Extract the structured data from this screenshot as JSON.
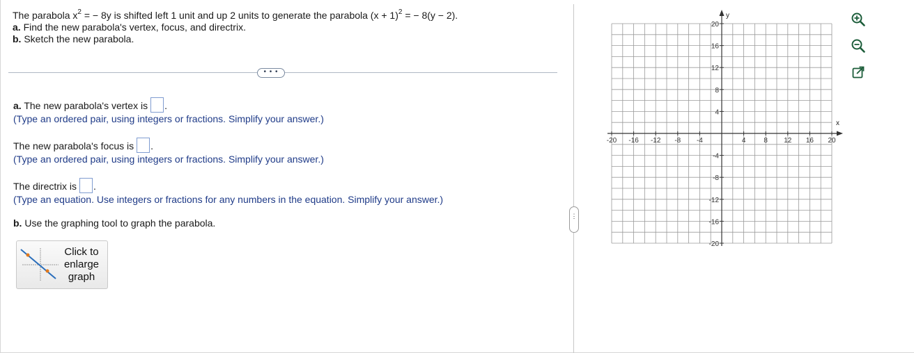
{
  "question": {
    "line1_pre": "The parabola x",
    "line1_exp1": "2",
    "line1_mid": " = − 8y is shifted left 1 unit and up 2 units to generate the parabola (x + 1)",
    "line1_exp2": "2",
    "line1_post": " = − 8(y − 2).",
    "part_a_label": "a.",
    "part_a_text": " Find the new parabola's vertex, focus, and directrix.",
    "part_b_label": "b.",
    "part_b_text": " Sketch the new parabola."
  },
  "expand_button": "• • •",
  "answers": {
    "vertex_label": "a.",
    "vertex_text": " The new parabola's vertex is",
    "vertex_hint": "(Type an ordered pair, using integers or fractions. Simplify your answer.)",
    "focus_text": "The new parabola's focus is",
    "focus_hint": "(Type an ordered pair, using integers or fractions. Simplify your answer.)",
    "directrix_text": "The directrix is",
    "directrix_hint": "(Type an equation. Use integers or fractions for any numbers in the equation. Simplify your answer.)",
    "graph_label": "b.",
    "graph_text": " Use the graphing tool to graph the parabola.",
    "period": "."
  },
  "enlarge_button": {
    "line1": "Click to",
    "line2": "enlarge",
    "line3": "graph"
  },
  "panel_handle": "⋮",
  "graph": {
    "x_range": [
      -20,
      20
    ],
    "y_range": [
      -20,
      20
    ],
    "grid_step": 2,
    "x_axis_label": "x",
    "y_axis_label": "y",
    "x_ticks": [
      "-20",
      "-16",
      "-12",
      "-8",
      "-4",
      "4",
      "8",
      "12",
      "16",
      "20"
    ],
    "y_ticks": [
      "20",
      "16",
      "12",
      "8",
      "4",
      "-4",
      "-8",
      "-12",
      "-16",
      "-20"
    ],
    "grid_color": "#9a9a9a",
    "axis_color": "#333333"
  },
  "tools": [
    "zoom-in-icon",
    "zoom-out-icon",
    "popout-icon"
  ]
}
